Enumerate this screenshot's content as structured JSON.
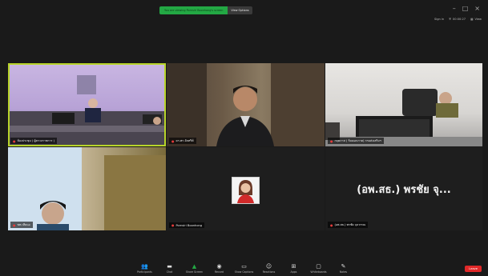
{
  "banner": {
    "message": "You are viewing Pornsiri Boonhong's screen",
    "view_options": "View Options"
  },
  "window": {
    "minimize": "–",
    "maximize": "□",
    "close": "×"
  },
  "top_right": {
    "signin": "Sign in",
    "recording": "00:00:27",
    "view": "View"
  },
  "participants": [
    {
      "name": "ห้องประชุม ( ผู้ตรวจราชการ )"
    },
    {
      "name": "ดร.พร อัลทรีฟ์"
    },
    {
      "name": "กฤตภาส ( ร้อยเอกภาค) กรมส่งเสริมฯ"
    },
    {
      "name": "พท.เทียนอ"
    },
    {
      "name": "Pornsiri Boonhong"
    },
    {
      "name": "(อพ.สธ.) พรชัย จุ...",
      "short_display": "(อพ.สธ.) พรชัย จุ...",
      "label": "(อพ.สธ.) พรชัย จุลวรรณ"
    }
  ],
  "toolbar": [
    {
      "label": "Participants",
      "icon": "participants-icon"
    },
    {
      "label": "Chat",
      "icon": "chat-icon"
    },
    {
      "label": "Share Screen",
      "icon": "share-screen-icon"
    },
    {
      "label": "Record",
      "icon": "record-icon"
    },
    {
      "label": "Show Captions",
      "icon": "captions-icon"
    },
    {
      "label": "Reactions",
      "icon": "reactions-icon"
    },
    {
      "label": "Apps",
      "icon": "apps-icon"
    },
    {
      "label": "Whiteboards",
      "icon": "whiteboards-icon"
    },
    {
      "label": "Notes",
      "icon": "notes-icon"
    }
  ],
  "leave": "Leave",
  "colors": {
    "active_border": "#b8d42a",
    "share_green": "#23a844",
    "leave_red": "#e02828"
  }
}
